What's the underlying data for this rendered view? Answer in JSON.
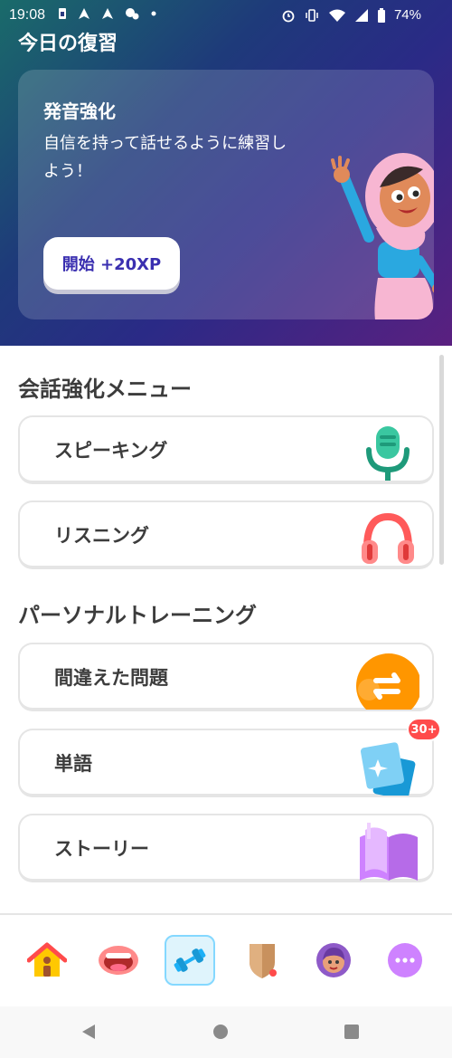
{
  "status_bar": {
    "time": "19:08",
    "battery": "74%"
  },
  "header": {
    "title": "今日の復習"
  },
  "promo": {
    "title": "発音強化",
    "description": "自信を持って話せるように練習しよう！",
    "button_label": "開始 +20XP",
    "accent_color": "#3a2fb0"
  },
  "sections": [
    {
      "title": "会話強化メニュー",
      "items": [
        {
          "label": "スピーキング",
          "icon": "microphone-icon"
        },
        {
          "label": "リスニング",
          "icon": "headphones-icon"
        }
      ]
    },
    {
      "title": "パーソナルトレーニング",
      "items": [
        {
          "label": "間違えた問題",
          "icon": "retry-icon"
        },
        {
          "label": "単語",
          "icon": "flashcards-icon",
          "badge": "30+"
        },
        {
          "label": "ストーリー",
          "icon": "book-icon"
        }
      ]
    }
  ],
  "bottom_nav": [
    {
      "icon": "home-icon",
      "active": false
    },
    {
      "icon": "mouth-icon",
      "active": false
    },
    {
      "icon": "dumbbell-icon",
      "active": true
    },
    {
      "icon": "shield-icon",
      "active": false
    },
    {
      "icon": "profile-icon",
      "active": false
    },
    {
      "icon": "more-icon",
      "active": false
    }
  ],
  "system_nav": [
    "back-icon",
    "home-circle-icon",
    "recents-icon"
  ]
}
